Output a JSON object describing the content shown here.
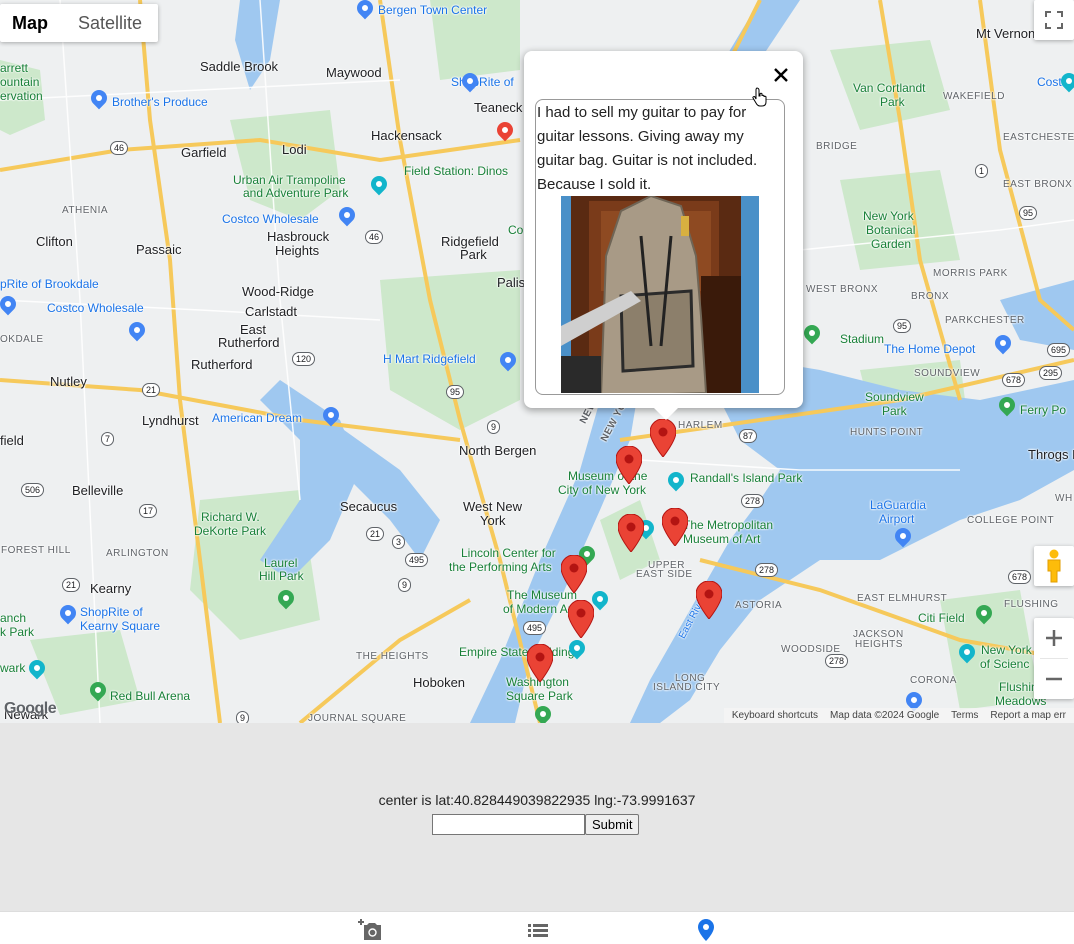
{
  "map": {
    "type_tabs": [
      {
        "label": "Map",
        "active": true
      },
      {
        "label": "Satellite",
        "active": false
      }
    ],
    "labels": {
      "bergen_town_center": "Bergen Town Center",
      "mt_vernon": "Mt Vernon",
      "saddle_brook": "Saddle Brook",
      "maywood": "Maywood",
      "shoprite_of": "ShopRite of",
      "teaneck": "Teaneck",
      "brothers_produce": "Brother's Produce",
      "hackensack": "Hackensack",
      "garfield": "Garfield",
      "lodi": "Lodi",
      "urban_air": "Urban Air Trampoline",
      "urban_air2": "and Adventure Park",
      "field_station": "Field Station: Dinos",
      "athenia": "ATHENIA",
      "costco_wholesale1": "Costco Wholesale",
      "hasbrouck": "Hasbrouck",
      "heights": "Heights",
      "ridgefield_park": "Ridgefield",
      "ridgefield_park2": "Park",
      "clifton": "Clifton",
      "passaic": "Passaic",
      "shoprite_brookdale": "pRite of Brookdale",
      "wood_ridge": "Wood-Ridge",
      "carlstadt": "Carlstadt",
      "costco_wholesale2": "Costco Wholesale",
      "east_rutherford": "East",
      "east_rutherford2": "Rutherford",
      "rutherford": "Rutherford",
      "h_mart": "H Mart Ridgefield",
      "nutley": "Nutley",
      "lyndhurst": "Lyndhurst",
      "american_dream": "American Dream",
      "north_bergen": "North Bergen",
      "belleville": "Belleville",
      "secaucus": "Secaucus",
      "west_new_york": "West New",
      "west_new_york2": "York",
      "richard_dekorte": "Richard W.",
      "richard_dekorte2": "DeKorte Park",
      "forest_hill": "FOREST HILL",
      "arlington": "ARLINGTON",
      "laurel_hill": "Laurel",
      "laurel_hill2": "Hill Park",
      "kearny": "Kearny",
      "shoprite_kearny": "ShopRite of",
      "shoprite_kearny2": "Kearny Square",
      "the_heights": "THE HEIGHTS",
      "hoboken": "Hoboken",
      "red_bull": "Red Bull Arena",
      "journal_square": "JOURNAL SQUARE",
      "newark": "Newark",
      "van_cortlandt": "Van Cortlandt",
      "van_cortlandt2": "Park",
      "wakefield": "WAKEFIELD",
      "eastchester": "EASTCHESTER",
      "costco_w": "Costco W",
      "east_bronx": "EAST BRONX",
      "ny_botanical": "New York",
      "ny_botanical2": "Botanical",
      "ny_botanical3": "Garden",
      "morris_park": "MORRIS PARK",
      "west_bronx": "WEST BRONX",
      "bronx": "BRONX",
      "parkchester": "PARKCHESTER",
      "stadium": "Stadium",
      "home_depot": "The Home Depot",
      "soundview": "SOUNDVIEW",
      "soundview_park": "Soundview",
      "soundview_park2": "Park",
      "ferry_point": "Ferry Po",
      "hunts_point": "HUNTS POINT",
      "throgs_neck": "Throgs Nec",
      "harlem": "HARLEM",
      "randalls": "Randall's Island Park",
      "museum_city": "Museum of the",
      "museum_city2": "City of New York",
      "metropolitan": "The Metropolitan",
      "metropolitan2": "Museum of Art",
      "laguardia": "LaGuardia",
      "laguardia2": "Airport",
      "college_point": "COLLEGE POINT",
      "lincoln_center": "Lincoln Center for",
      "lincoln_center2": "the Performing Arts",
      "upper_east_side": "UPPER",
      "upper_east_side2": "EAST SIDE",
      "astoria": "ASTORIA",
      "east_elmhurst": "EAST ELMHURST",
      "flushing": "FLUSHING",
      "moma": "The Museum",
      "moma2": "of Modern Art",
      "citi_field": "Citi Field",
      "jackson_heights": "JACKSON",
      "jackson_heights2": "HEIGHTS",
      "woodside": "WOODSIDE",
      "ny_science": "New York",
      "ny_science2": "of Scienc",
      "empire_state": "Empire State Building",
      "long_island_city": "LONG",
      "long_island_city2": "ISLAND CITY",
      "corona": "CORONA",
      "flushing_meadows": "Flushing",
      "flushing_meadows2": "Meadows",
      "washington_sq": "Washington",
      "washington_sq2": "Square Park",
      "wh": "WH",
      "bridge": "BRIDGE",
      "palis": "Palis",
      "co": "Co",
      "ountain": "ountain",
      "ervation": "ervation",
      "arrett": "arrett",
      "okdale": "OKDALE",
      "field": "field",
      "anch": "anch",
      "k_park": "k Park",
      "wark": "wark",
      "new_je": "NEW JE",
      "new_york_label": "NEW YO",
      "east_river": "East River"
    },
    "route_shields": [
      "46",
      "46",
      "21",
      "120",
      "95",
      "9",
      "495",
      "3",
      "9",
      "7",
      "21",
      "17",
      "506",
      "21",
      "495",
      "278",
      "278",
      "87",
      "95",
      "1",
      "95",
      "95",
      "678",
      "295",
      "695",
      "278",
      "678",
      "9"
    ],
    "google_logo": "Google",
    "attribution": {
      "keyboard": "Keyboard shortcuts",
      "mapdata": "Map data ©2024 Google",
      "terms": "Terms",
      "report": "Report a map err"
    },
    "markers": 9,
    "colors": {
      "marker": "#ea4335",
      "water": "#9ecbf6",
      "park": "#c4e6c4",
      "highway": "#fbd56b"
    }
  },
  "infowindow": {
    "text": "I had to sell my guitar to pay for guitar lessons. Giving away my guitar bag. Guitar is not included. Because I sold it.",
    "close_icon": "close-icon"
  },
  "center": {
    "text": "center is lat:40.828449039822935 lng:-73.9991637"
  },
  "form": {
    "input_value": "",
    "submit_label": "Submit"
  },
  "nav": {
    "items": [
      {
        "icon": "add-photo-icon"
      },
      {
        "icon": "list-icon"
      },
      {
        "icon": "map-pin-icon",
        "active": true
      }
    ],
    "active_color": "#1a73e8"
  }
}
